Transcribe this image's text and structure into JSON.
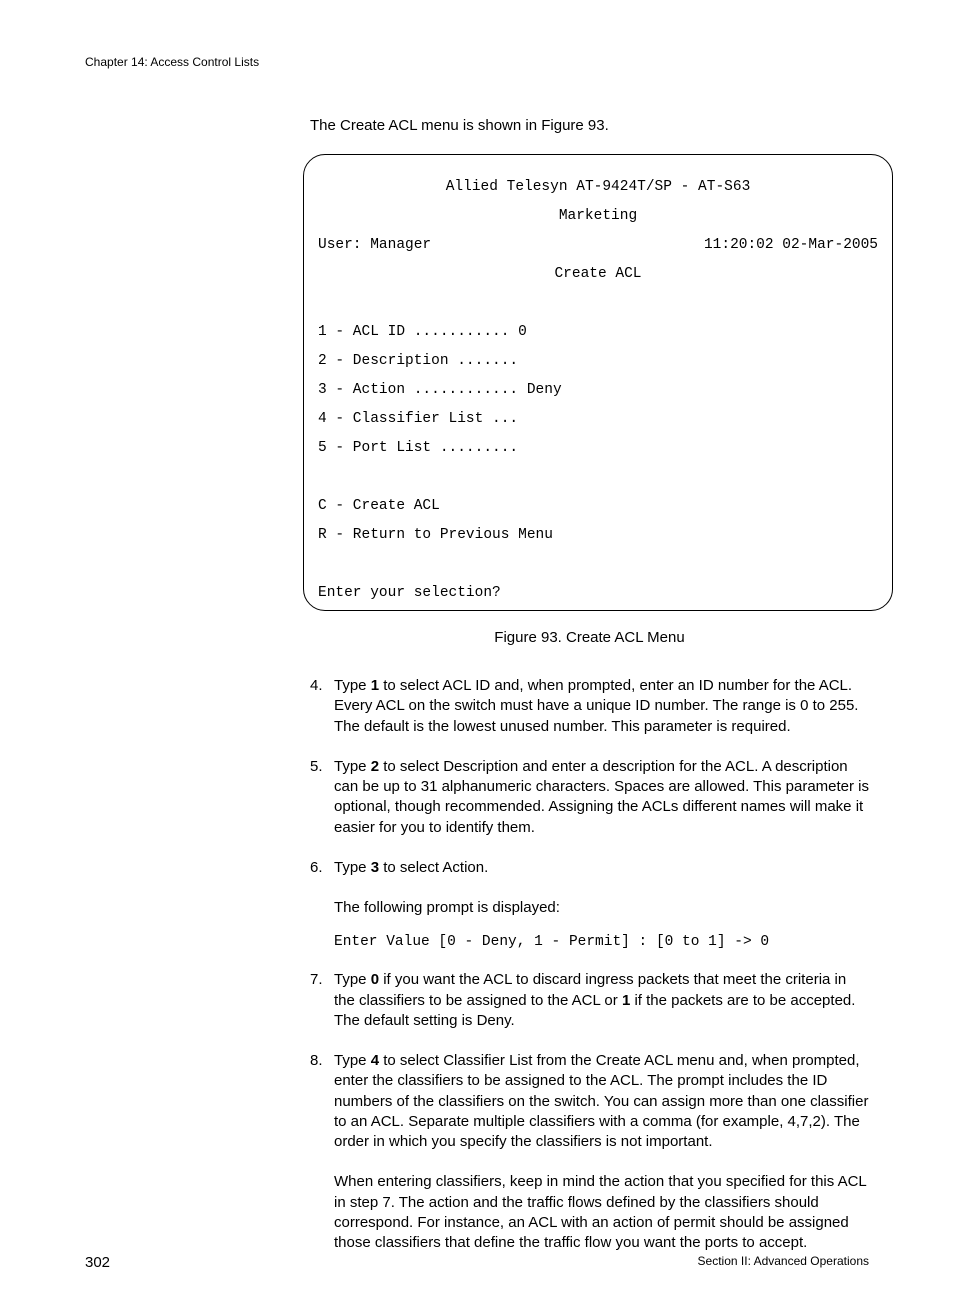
{
  "header": {
    "chapter": "Chapter 14: Access Control Lists"
  },
  "intro": "The Create ACL menu is shown in Figure 93.",
  "terminal": {
    "title": "Allied Telesyn AT-9424T/SP - AT-S63",
    "subtitle": "Marketing",
    "user": "User: Manager",
    "timestamp": "11:20:02 02-Mar-2005",
    "menu_title": "Create ACL",
    "items": [
      "1 - ACL ID ........... 0",
      "2 - Description .......",
      "3 - Action ............ Deny",
      "4 - Classifier List ...",
      "5 - Port List ........."
    ],
    "actions": [
      "C - Create ACL",
      "R - Return to Previous Menu"
    ],
    "prompt": "Enter your selection?"
  },
  "figure_caption": "Figure 93. Create ACL Menu",
  "steps": {
    "s4": {
      "num": "4.",
      "pre": "Type ",
      "bold": "1",
      "post": " to select ACL ID and, when prompted, enter an ID number for the ACL. Every ACL on the switch must have a unique ID number. The range is 0 to 255. The default is the lowest unused number. This parameter is required."
    },
    "s5": {
      "num": "5.",
      "pre": "Type ",
      "bold": "2",
      "post": " to select Description and enter a description for the ACL. A description can be up to 31 alphanumeric characters. Spaces are allowed. This parameter is optional, though recommended. Assigning the ACLs different names will make it easier for you to identify them."
    },
    "s6": {
      "num": "6.",
      "pre": "Type ",
      "bold": "3",
      "post": " to select Action.",
      "follow": "The following prompt is displayed:",
      "prompt_line": "Enter Value [0 - Deny, 1 - Permit] : [0 to 1] -> 0"
    },
    "s7": {
      "num": "7.",
      "pre": "Type ",
      "bold1": "0",
      "mid": " if you want the ACL to discard ingress packets that meet the criteria in the classifiers to be assigned to the ACL or ",
      "bold2": "1",
      "post": " if the packets are to be accepted. The default setting is Deny."
    },
    "s8": {
      "num": "8.",
      "pre": "Type ",
      "bold": "4",
      "post": " to select Classifier List from the Create ACL menu and, when prompted, enter the classifiers to be assigned to the ACL. The prompt includes the ID numbers of the classifiers on the switch. You can assign more than one classifier to an ACL. Separate multiple classifiers with a comma (for example, 4,7,2). The order in which you specify the classifiers is not important.",
      "para2": "When entering classifiers, keep in mind the action that you specified for this ACL in step 7. The action and the traffic flows defined by the classifiers should correspond. For instance, an ACL with an action of permit should be assigned those classifiers that define the traffic flow you want the ports to accept."
    }
  },
  "footer": {
    "page_num": "302",
    "section": "Section II: Advanced Operations"
  }
}
